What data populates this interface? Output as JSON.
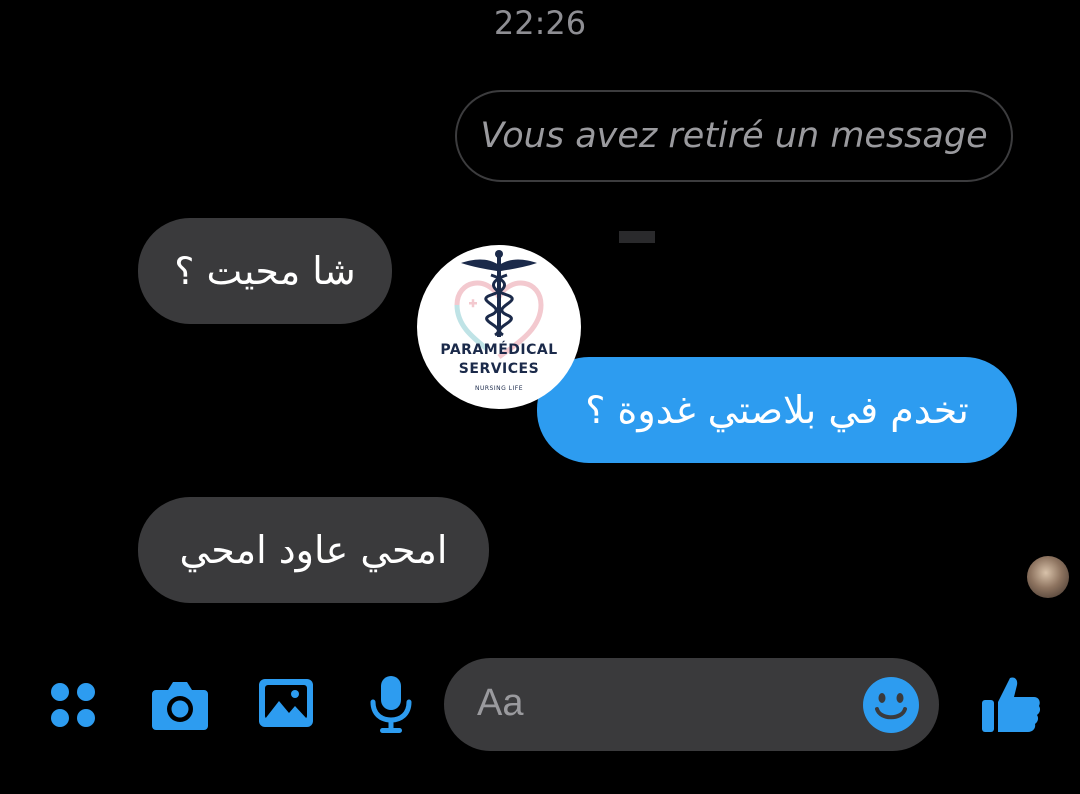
{
  "conversation": {
    "timestamp": "22:26",
    "unsent_notice": "Vous avez retiré un message",
    "messages": [
      {
        "direction": "incoming",
        "text": "شا محيت ؟"
      },
      {
        "direction": "outgoing",
        "text": "تخدم في بلاصتي غدوة ؟"
      },
      {
        "direction": "incoming",
        "text": "امحي عاود امحي"
      }
    ]
  },
  "watermark": {
    "line1": "PARAMÉDICAL",
    "line2": "SERVICES",
    "line3": "NURSING LIFE"
  },
  "composer": {
    "placeholder": "Aa"
  },
  "toolbar": {
    "icons": [
      "apps-icon",
      "camera-icon",
      "image-icon",
      "microphone-icon",
      "emoji-icon",
      "thumbs-up-icon"
    ]
  },
  "colors": {
    "background": "#000000",
    "incoming_bubble": "#3a3a3c",
    "outgoing_bubble": "#2d9cf0",
    "accent": "#2d9cf0"
  }
}
